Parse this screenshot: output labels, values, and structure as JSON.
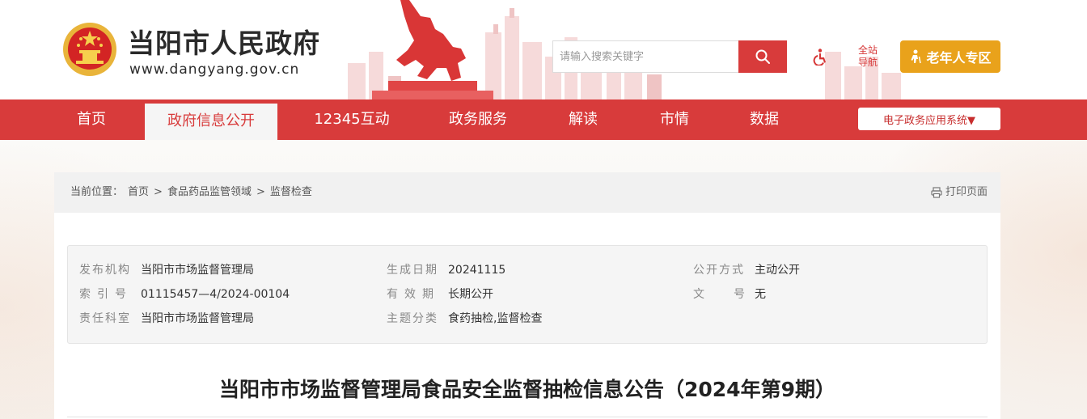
{
  "header": {
    "site_name": "当阳市人民政府",
    "site_url": "www.dangyang.gov.cn",
    "search_placeholder": "请输入搜索关键字",
    "site_nav_line1": "全站",
    "site_nav_line2": "导航",
    "elder_label": "老年人专区"
  },
  "nav": {
    "items": [
      {
        "label": "首页"
      },
      {
        "label": "政府信息公开"
      },
      {
        "label": "12345互动"
      },
      {
        "label": "政务服务"
      },
      {
        "label": "解读"
      },
      {
        "label": "市情"
      },
      {
        "label": "数据"
      }
    ],
    "active_index": 1,
    "ext_label": "电子政务应用系统▼"
  },
  "breadcrumb": {
    "prefix": "当前位置：",
    "items": [
      "首页",
      "食品药品监管领域",
      "监督检查"
    ],
    "separator": ">"
  },
  "print_label": "打印页面",
  "meta": {
    "publisher_key": "发布机构",
    "publisher_val": "当阳市市场监督管理局",
    "date_key": "生成日期",
    "date_val": "20241115",
    "mode_key": "公开方式",
    "mode_val": "主动公开",
    "index_key": "索引号",
    "index_val": "01115457—4/2024-00104",
    "valid_key": "有效期",
    "valid_val": "长期公开",
    "docno_key": "文号",
    "docno_val": "无",
    "dept_key": "责任科室",
    "dept_val": "当阳市市场监督管理局",
    "topic_key": "主题分类",
    "topic_val": "食药抽检,监督检查"
  },
  "article": {
    "title": "当阳市市场监督管理局食品安全监督抽检信息公告（2024年第9期）"
  },
  "colors": {
    "brand_red": "#d83b3b",
    "elder_orange": "#e9a21b"
  }
}
